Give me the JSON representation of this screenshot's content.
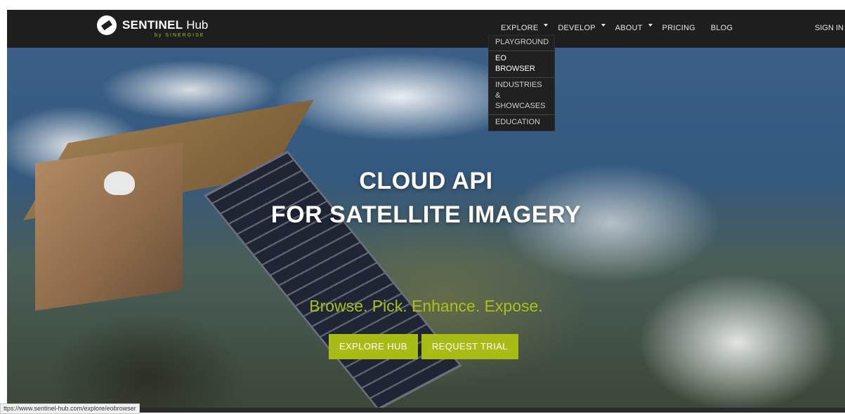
{
  "brand": {
    "name_bold": "SENTINEL",
    "name_light": "Hub",
    "sub": "by SINERGISE"
  },
  "nav": {
    "items": [
      {
        "label": "EXPLORE",
        "dropdown": true
      },
      {
        "label": "DEVELOP",
        "dropdown": true
      },
      {
        "label": "ABOUT",
        "dropdown": true
      },
      {
        "label": "PRICING",
        "dropdown": false
      },
      {
        "label": "BLOG",
        "dropdown": false
      }
    ],
    "signin": "SIGN IN"
  },
  "dropdown": {
    "items": [
      {
        "label": "PLAYGROUND"
      },
      {
        "label": "EO BROWSER"
      },
      {
        "label": "INDUSTRIES & SHOWCASES"
      },
      {
        "label": "EDUCATION"
      }
    ]
  },
  "hero": {
    "title_line1": "CLOUD API",
    "title_line2": "FOR SATELLITE IMAGERY",
    "tagline": "Browse. Pick. Enhance. Expose.",
    "button_explore": "EXPLORE HUB",
    "button_trial": "REQUEST TRIAL"
  },
  "status_url": "ttps://www.sentinel-hub.com/explore/eobrowser",
  "colors": {
    "accent": "#a7bd16",
    "navbar": "#1e1e1e"
  }
}
